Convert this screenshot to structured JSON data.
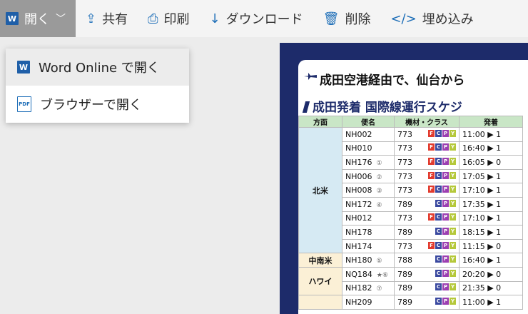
{
  "toolbar": {
    "open_label": "開く",
    "share_label": "共有",
    "print_label": "印刷",
    "download_label": "ダウンロード",
    "delete_label": "削除",
    "embed_label": "埋め込み"
  },
  "menu": {
    "word_online_label": "Word Online で開く",
    "browser_label": "ブラウザーで開く"
  },
  "document": {
    "title": "成田空港経由で、仙台から",
    "subtitle": "成田発着 国際線運行スケジ",
    "headers": [
      "方面",
      "便名",
      "機材・クラス",
      "発着"
    ],
    "rows": [
      {
        "region": "北米",
        "flight": "NH002",
        "mark": "",
        "aircraft": "773",
        "classes": [
          "F",
          "C",
          "P",
          "Y"
        ],
        "time": "11:00 ▶ 1"
      },
      {
        "region": "",
        "flight": "NH010",
        "mark": "",
        "aircraft": "773",
        "classes": [
          "F",
          "C",
          "P",
          "Y"
        ],
        "time": "16:40 ▶ 1"
      },
      {
        "region": "",
        "flight": "NH176",
        "mark": "①",
        "aircraft": "773",
        "classes": [
          "F",
          "C",
          "P",
          "Y"
        ],
        "time": "16:05 ▶ 0"
      },
      {
        "region": "",
        "flight": "NH006",
        "mark": "②",
        "aircraft": "773",
        "classes": [
          "F",
          "C",
          "P",
          "Y"
        ],
        "time": "17:05 ▶ 1"
      },
      {
        "region": "",
        "flight": "NH008",
        "mark": "③",
        "aircraft": "773",
        "classes": [
          "F",
          "C",
          "P",
          "Y"
        ],
        "time": "17:10 ▶ 1"
      },
      {
        "region": "",
        "flight": "NH172",
        "mark": "④",
        "aircraft": "789",
        "classes": [
          "C",
          "P",
          "Y"
        ],
        "time": "17:35 ▶ 1"
      },
      {
        "region": "",
        "flight": "NH012",
        "mark": "",
        "aircraft": "773",
        "classes": [
          "F",
          "C",
          "P",
          "Y"
        ],
        "time": "17:10 ▶ 1"
      },
      {
        "region": "",
        "flight": "NH178",
        "mark": "",
        "aircraft": "789",
        "classes": [
          "C",
          "P",
          "Y"
        ],
        "time": "18:15 ▶ 1"
      },
      {
        "region": "",
        "flight": "NH174",
        "mark": "",
        "aircraft": "773",
        "classes": [
          "F",
          "C",
          "P",
          "Y"
        ],
        "time": "11:15 ▶ 0"
      },
      {
        "region": "中南米",
        "flight": "NH180",
        "mark": "⑤",
        "aircraft": "788",
        "classes": [
          "C",
          "P",
          "Y"
        ],
        "time": "16:40 ▶ 1"
      },
      {
        "region": "ハワイ",
        "flight": "NQ184",
        "mark": "★⑥",
        "aircraft": "789",
        "classes": [
          "C",
          "P",
          "Y"
        ],
        "time": "20:20 ▶ 0"
      },
      {
        "region": "",
        "flight": "NH182",
        "mark": "⑦",
        "aircraft": "789",
        "classes": [
          "C",
          "P",
          "Y"
        ],
        "time": "21:35 ▶ 0"
      },
      {
        "region": "",
        "flight": "NH209",
        "mark": "",
        "aircraft": "789",
        "classes": [
          "C",
          "P",
          "Y"
        ],
        "time": "11:00 ▶ 1"
      }
    ]
  }
}
